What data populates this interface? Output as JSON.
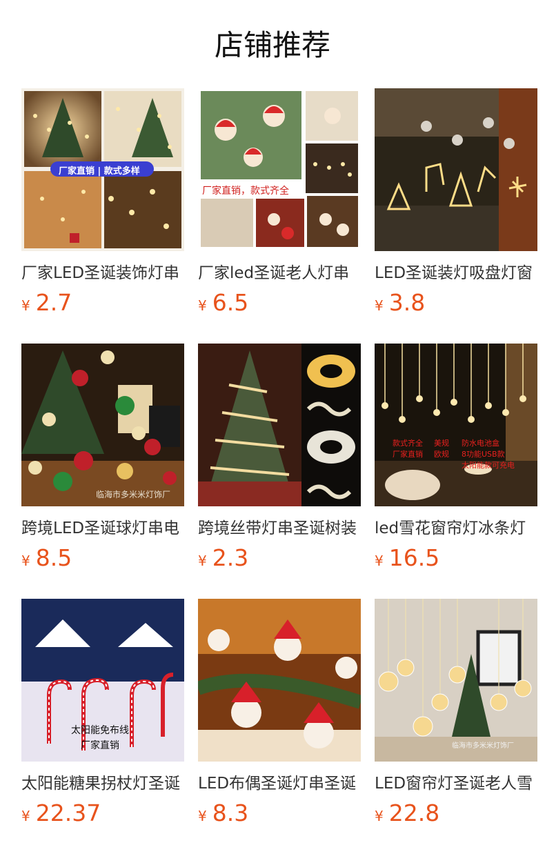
{
  "section_title": "店铺推荐",
  "currency_symbol": "¥",
  "products": [
    {
      "name": "厂家LED圣诞装饰灯串",
      "price": "2.7",
      "tag": "厂家直销 | 款式多样"
    },
    {
      "name": "厂家led圣诞老人灯串",
      "price": "6.5",
      "tag": "厂家直销，款式齐全"
    },
    {
      "name": "LED圣诞装灯吸盘灯窗",
      "price": "3.8"
    },
    {
      "name": "跨境LED圣诞球灯串电",
      "price": "8.5",
      "tag": "临海市多米米灯饰厂"
    },
    {
      "name": "跨境丝带灯串圣诞树装",
      "price": "2.3"
    },
    {
      "name": "led雪花窗帘灯冰条灯",
      "price": "16.5",
      "tag_lines": [
        "款式齐全",
        "美规",
        "防水电池盒",
        "厂家直销",
        "欧规",
        "8功能USB款",
        "太阳能款可充电"
      ]
    },
    {
      "name": "太阳能糖果拐杖灯圣诞",
      "price": "22.37",
      "tag_lines": [
        "太阳能免布线",
        "厂家直销"
      ]
    },
    {
      "name": "LED布偶圣诞灯串圣诞",
      "price": "8.3"
    },
    {
      "name": "LED窗帘灯圣诞老人雪",
      "price": "22.8",
      "tag": "临海市多米米灯饰厂"
    }
  ],
  "colors": {
    "price": "#e8531c",
    "text": "#333333"
  }
}
